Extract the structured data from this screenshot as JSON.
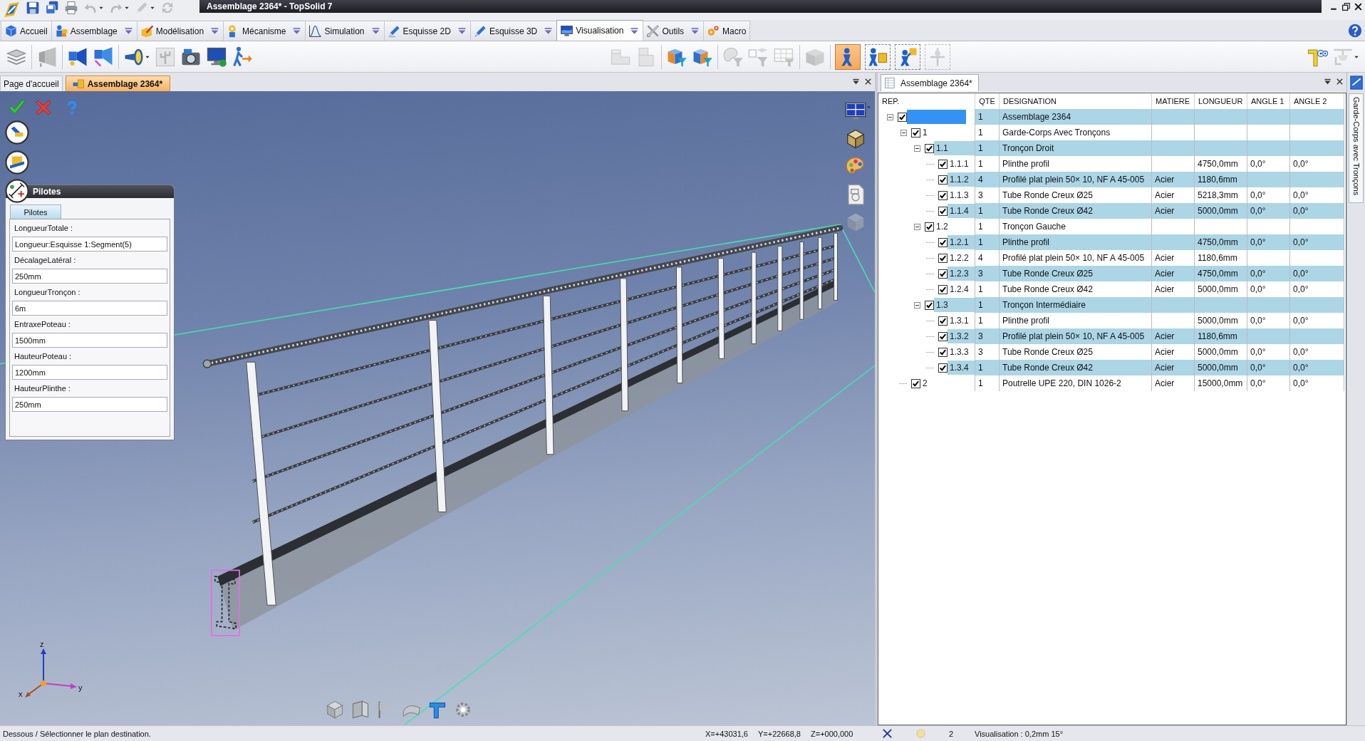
{
  "window": {
    "title": "Assemblage 2364* - TopSolid 7"
  },
  "quick_access": [
    {
      "kind": "app-logo",
      "disabled": false
    },
    {
      "kind": "save",
      "disabled": false
    },
    {
      "kind": "save-all",
      "disabled": false
    },
    {
      "kind": "print",
      "disabled": false
    },
    {
      "kind": "undo",
      "disabled": true,
      "menu": true
    },
    {
      "kind": "redo",
      "disabled": true,
      "menu": true
    },
    {
      "kind": "pencil",
      "disabled": true,
      "menu": true
    },
    {
      "kind": "refresh",
      "disabled": true
    }
  ],
  "ribbon_tabs": [
    {
      "kind": "home",
      "label": "Accueil",
      "selected": false,
      "menu": false
    },
    {
      "kind": "assembly",
      "label": "Assemblage",
      "selected": false,
      "menu": true
    },
    {
      "kind": "modeling",
      "label": "Modélisation",
      "selected": false,
      "menu": true
    },
    {
      "kind": "mechanism",
      "label": "Mécanisme",
      "selected": false,
      "menu": true
    },
    {
      "kind": "simulation",
      "label": "Simulation",
      "selected": false,
      "menu": true
    },
    {
      "kind": "sketch-2d",
      "label": "Esquisse 2D",
      "selected": false,
      "menu": true
    },
    {
      "kind": "sketch-3d",
      "label": "Esquisse 3D",
      "selected": false,
      "menu": true
    },
    {
      "kind": "visualization",
      "label": "Visualisation",
      "selected": true,
      "menu": true
    },
    {
      "kind": "tools",
      "label": "Outils",
      "selected": false,
      "menu": true
    },
    {
      "kind": "macro",
      "label": "Macro",
      "selected": false,
      "menu": false
    }
  ],
  "toolbar": {
    "left": [
      [
        {
          "kind": "layers",
          "disabled": false
        }
      ],
      [
        {
          "kind": "spotlight",
          "disabled": true
        }
      ],
      [
        {
          "kind": "projector",
          "disabled": false
        },
        {
          "kind": "projector-light",
          "disabled": false
        }
      ],
      [
        {
          "kind": "flashlight",
          "disabled": false,
          "menu": true
        },
        {
          "kind": "plant",
          "disabled": true
        },
        {
          "kind": "camera",
          "disabled": false
        },
        {
          "kind": "monitor-sync",
          "disabled": false
        },
        {
          "kind": "walker",
          "disabled": false
        }
      ]
    ],
    "center": [
      [
        {
          "kind": "blocks",
          "disabled": true
        },
        {
          "kind": "blocks-2",
          "disabled": true
        }
      ],
      [
        {
          "kind": "cube-funnel",
          "disabled": false
        },
        {
          "kind": "cube-funnel-2",
          "disabled": false
        }
      ],
      [
        {
          "kind": "palette-funnel",
          "disabled": true
        },
        {
          "kind": "shapes-funnel",
          "disabled": true
        },
        {
          "kind": "table-funnel",
          "disabled": true
        }
      ],
      [
        {
          "kind": "box",
          "disabled": true
        }
      ],
      [
        {
          "kind": "person",
          "on": true,
          "disabled": false
        },
        {
          "kind": "person-part",
          "on": false,
          "disabled": false
        },
        {
          "kind": "person-link",
          "on": false,
          "disabled": false
        },
        {
          "kind": "person-line",
          "on": false,
          "disabled": true
        }
      ]
    ],
    "right": [
      [
        {
          "kind": "bracket-face",
          "disabled": false
        },
        {
          "kind": "lamp",
          "disabled": true,
          "menu": true
        }
      ]
    ]
  },
  "document_tabs": [
    {
      "kind": "page",
      "label": "Page d'accueil",
      "selected": false
    },
    {
      "kind": "assembly",
      "label": "Assemblage 2364*",
      "selected": true
    }
  ],
  "viewport": {
    "view_tools": [
      {
        "kind": "monitor-view",
        "disabled": false,
        "menu": true
      },
      {
        "kind": "cube-tex",
        "disabled": false
      },
      {
        "kind": "palette",
        "disabled": false
      },
      {
        "kind": "doc-page",
        "disabled": false
      },
      {
        "kind": "cube-plain",
        "disabled": true
      }
    ],
    "pilotes_panel": {
      "title": "Pilotes",
      "tabs": [
        {
          "label": "Pilotes",
          "selected": true
        }
      ],
      "fields": [
        {
          "label": "LongueurTotale :",
          "value": "Longueur:Esquisse 1:Segment(5)"
        },
        {
          "label": "DécalageLatéral :",
          "value": "250mm"
        },
        {
          "label": "LongueurTronçon :",
          "value": "6m"
        },
        {
          "label": "EntraxePoteau :",
          "value": "1500mm"
        },
        {
          "label": "HauteurPoteau :",
          "value": "1200mm"
        },
        {
          "label": "HauteurPlinthe :",
          "value": "250mm"
        }
      ]
    },
    "axis_labels": [
      "z",
      "x",
      "y"
    ]
  },
  "pane_tabs": [
    {
      "label": "Assemblage 2364*",
      "selected": true
    }
  ],
  "side_tab": {
    "label": "Garde-Corps avec Tronçons"
  },
  "tree_table": {
    "columns": [
      "REP.",
      "QTE",
      "DESIGNATION",
      "MATIERE",
      "LONGUEUR",
      "ANGLE 1",
      "ANGLE 2"
    ],
    "rows": [
      {
        "qte": "1",
        "designation": "Assemblage 2364",
        "checked": true,
        "selected": true,
        "expanded": true,
        "children": [
          {
            "rep": "1",
            "qte": "1",
            "designation": "Garde-Corps Avec Tronçons",
            "checked": true,
            "selected": false,
            "expanded": true,
            "children": [
              {
                "rep": "1.1",
                "qte": "1",
                "designation": "Tronçon Droit",
                "checked": true,
                "selected": false,
                "expanded": true,
                "children": [
                  {
                    "rep": "1.1.1",
                    "qte": "1",
                    "designation": "Plinthe profil",
                    "longueur": "4750,0mm",
                    "angle_1": "0,0°",
                    "angle_2": "0,0°",
                    "checked": true,
                    "selected": false
                  },
                  {
                    "rep": "1.1.2",
                    "qte": "4",
                    "designation": "Profilé plat plein 50× 10, NF A 45-005",
                    "matiere": "Acier",
                    "longueur": "1180,6mm",
                    "checked": true,
                    "selected": false
                  },
                  {
                    "rep": "1.1.3",
                    "qte": "3",
                    "designation": "Tube Ronde Creux Ø25",
                    "matiere": "Acier",
                    "longueur": "5218,3mm",
                    "angle_1": "0,0°",
                    "angle_2": "0,0°",
                    "checked": true,
                    "selected": false
                  },
                  {
                    "rep": "1.1.4",
                    "qte": "1",
                    "designation": "Tube Ronde Creux Ø42",
                    "matiere": "Acier",
                    "longueur": "5000,0mm",
                    "angle_1": "0,0°",
                    "angle_2": "0,0°",
                    "checked": true,
                    "selected": false
                  }
                ]
              },
              {
                "rep": "1.2",
                "qte": "1",
                "designation": "Tronçon Gauche",
                "checked": true,
                "selected": false,
                "expanded": true,
                "children": [
                  {
                    "rep": "1.2.1",
                    "qte": "1",
                    "designation": "Plinthe profil",
                    "longueur": "4750,0mm",
                    "angle_1": "0,0°",
                    "angle_2": "0,0°",
                    "checked": true,
                    "selected": false
                  },
                  {
                    "rep": "1.2.2",
                    "qte": "4",
                    "designation": "Profilé plat plein 50× 10, NF A 45-005",
                    "matiere": "Acier",
                    "longueur": "1180,6mm",
                    "checked": true,
                    "selected": false
                  },
                  {
                    "rep": "1.2.3",
                    "qte": "3",
                    "designation": "Tube Ronde Creux Ø25",
                    "matiere": "Acier",
                    "longueur": "4750,0mm",
                    "angle_1": "0,0°",
                    "angle_2": "0,0°",
                    "checked": true,
                    "selected": false
                  },
                  {
                    "rep": "1.2.4",
                    "qte": "1",
                    "designation": "Tube Ronde Creux Ø42",
                    "matiere": "Acier",
                    "longueur": "5000,0mm",
                    "angle_1": "0,0°",
                    "angle_2": "0,0°",
                    "checked": true,
                    "selected": false
                  }
                ]
              },
              {
                "rep": "1.3",
                "qte": "1",
                "designation": "Tronçon Intermédiaire",
                "checked": true,
                "selected": false,
                "expanded": true,
                "children": [
                  {
                    "rep": "1.3.1",
                    "qte": "1",
                    "designation": "Plinthe profil",
                    "longueur": "5000,0mm",
                    "angle_1": "0,0°",
                    "angle_2": "0,0°",
                    "checked": true,
                    "selected": false
                  },
                  {
                    "rep": "1.3.2",
                    "qte": "3",
                    "designation": "Profilé plat plein 50× 10, NF A 45-005",
                    "matiere": "Acier",
                    "longueur": "1180,6mm",
                    "checked": true,
                    "selected": false
                  },
                  {
                    "rep": "1.3.3",
                    "qte": "3",
                    "designation": "Tube Ronde Creux Ø25",
                    "matiere": "Acier",
                    "longueur": "5000,0mm",
                    "angle_1": "0,0°",
                    "angle_2": "0,0°",
                    "checked": true,
                    "selected": false
                  },
                  {
                    "rep": "1.3.4",
                    "qte": "1",
                    "designation": "Tube Ronde Creux Ø42",
                    "matiere": "Acier",
                    "longueur": "5000,0mm",
                    "angle_1": "0,0°",
                    "angle_2": "0,0°",
                    "checked": true,
                    "selected": false
                  }
                ]
              }
            ]
          },
          {
            "rep": "2",
            "qte": "1",
            "designation": "Poutrelle UPE 220, DIN 1026-2",
            "matiere": "Acier",
            "longueur": "15000,0mm",
            "angle_1": "0,0°",
            "angle_2": "0,0°",
            "checked": true,
            "selected": false
          }
        ]
      }
    ]
  },
  "status_bar": {
    "message": "Dessous / Sélectionner le plan destination.",
    "coordinates": [
      "X=+43031,6",
      "Y=+22668,8",
      "Z=+000,000"
    ],
    "count": "2",
    "view_info": "Visualisation : 0,2mm 15°"
  }
}
